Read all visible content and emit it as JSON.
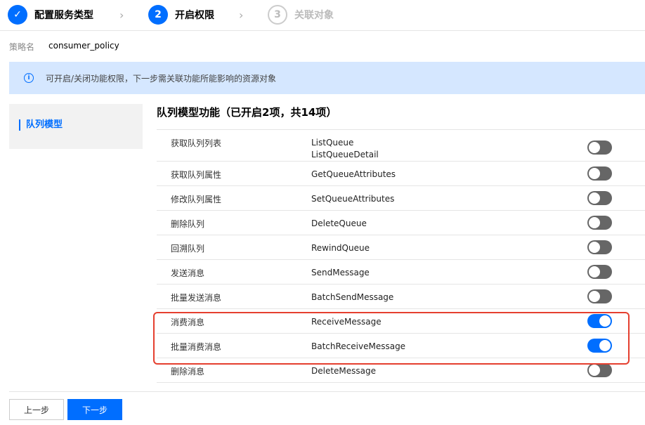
{
  "steps": [
    {
      "num": "✓",
      "label": "配置服务类型",
      "state": "done"
    },
    {
      "num": "2",
      "label": "开启权限",
      "state": "active"
    },
    {
      "num": "3",
      "label": "关联对象",
      "state": "todo"
    }
  ],
  "policy": {
    "key": "策略名",
    "value": "consumer_policy"
  },
  "banner": {
    "text": "可开启/关闭功能权限，下一步需关联功能所能影响的资源对象"
  },
  "sidebar": {
    "items": [
      {
        "label": "队列模型"
      }
    ]
  },
  "main": {
    "title": "队列模型功能（已开启2项，共14项）",
    "rows": [
      {
        "name": "获取队列列表",
        "apis": [
          "ListQueue",
          "ListQueueDetail"
        ],
        "enabled": false
      },
      {
        "name": "获取队列属性",
        "apis": [
          "GetQueueAttributes"
        ],
        "enabled": false
      },
      {
        "name": "修改队列属性",
        "apis": [
          "SetQueueAttributes"
        ],
        "enabled": false
      },
      {
        "name": "删除队列",
        "apis": [
          "DeleteQueue"
        ],
        "enabled": false
      },
      {
        "name": "回溯队列",
        "apis": [
          "RewindQueue"
        ],
        "enabled": false
      },
      {
        "name": "发送消息",
        "apis": [
          "SendMessage"
        ],
        "enabled": false
      },
      {
        "name": "批量发送消息",
        "apis": [
          "BatchSendMessage"
        ],
        "enabled": false
      },
      {
        "name": "消费消息",
        "apis": [
          "ReceiveMessage"
        ],
        "enabled": true
      },
      {
        "name": "批量消费消息",
        "apis": [
          "BatchReceiveMessage"
        ],
        "enabled": true
      },
      {
        "name": "删除消息",
        "apis": [
          "DeleteMessage"
        ],
        "enabled": false
      }
    ]
  },
  "footer": {
    "prev_label": "上一步",
    "next_label": "下一步"
  },
  "colors": {
    "accent": "#006eff",
    "toggle_off": "#666666",
    "banner_bg": "#d5e7ff",
    "highlight": "#e53f2f"
  }
}
